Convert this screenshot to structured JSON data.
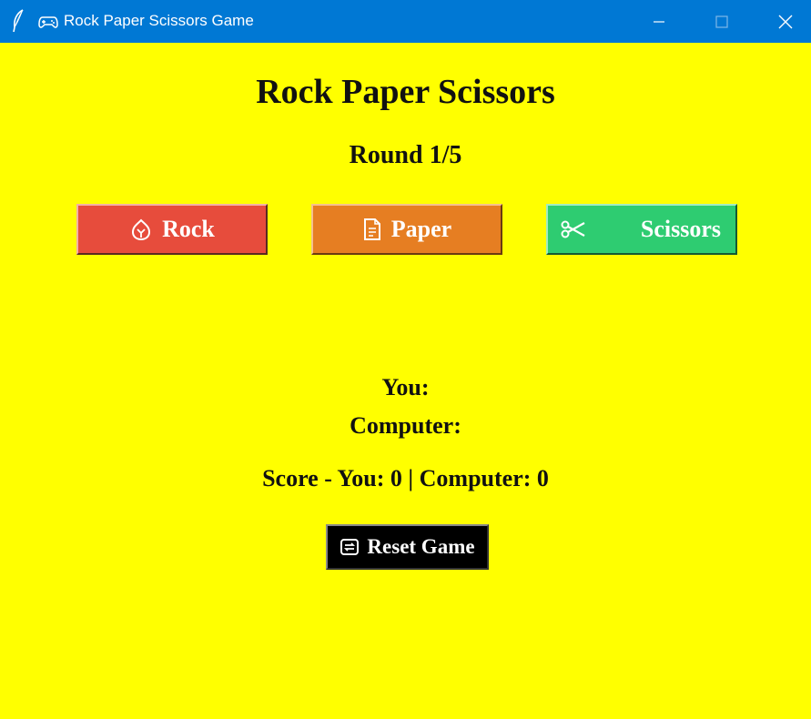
{
  "window": {
    "title": "Rock Paper Scissors Game",
    "app_icon": "feather-icon",
    "title_icon": "gamepad-icon",
    "titlebar_color": "#0078d4"
  },
  "game": {
    "heading": "Rock Paper Scissors",
    "round": "Round 1/5",
    "choices": [
      {
        "label": "Rock",
        "icon": "rock-icon",
        "color": "#e74c3c"
      },
      {
        "label": "Paper",
        "icon": "paper-icon",
        "color": "#e67e22"
      },
      {
        "label": "Scissors",
        "icon": "scissors-icon",
        "color": "#2ecc71"
      }
    ],
    "you_label": "You:",
    "computer_label": "Computer:",
    "score": "Score - You: 0 | Computer: 0",
    "reset_label": "Reset Game",
    "reset_icon": "reset-icon",
    "background_color": "#ffff00"
  }
}
